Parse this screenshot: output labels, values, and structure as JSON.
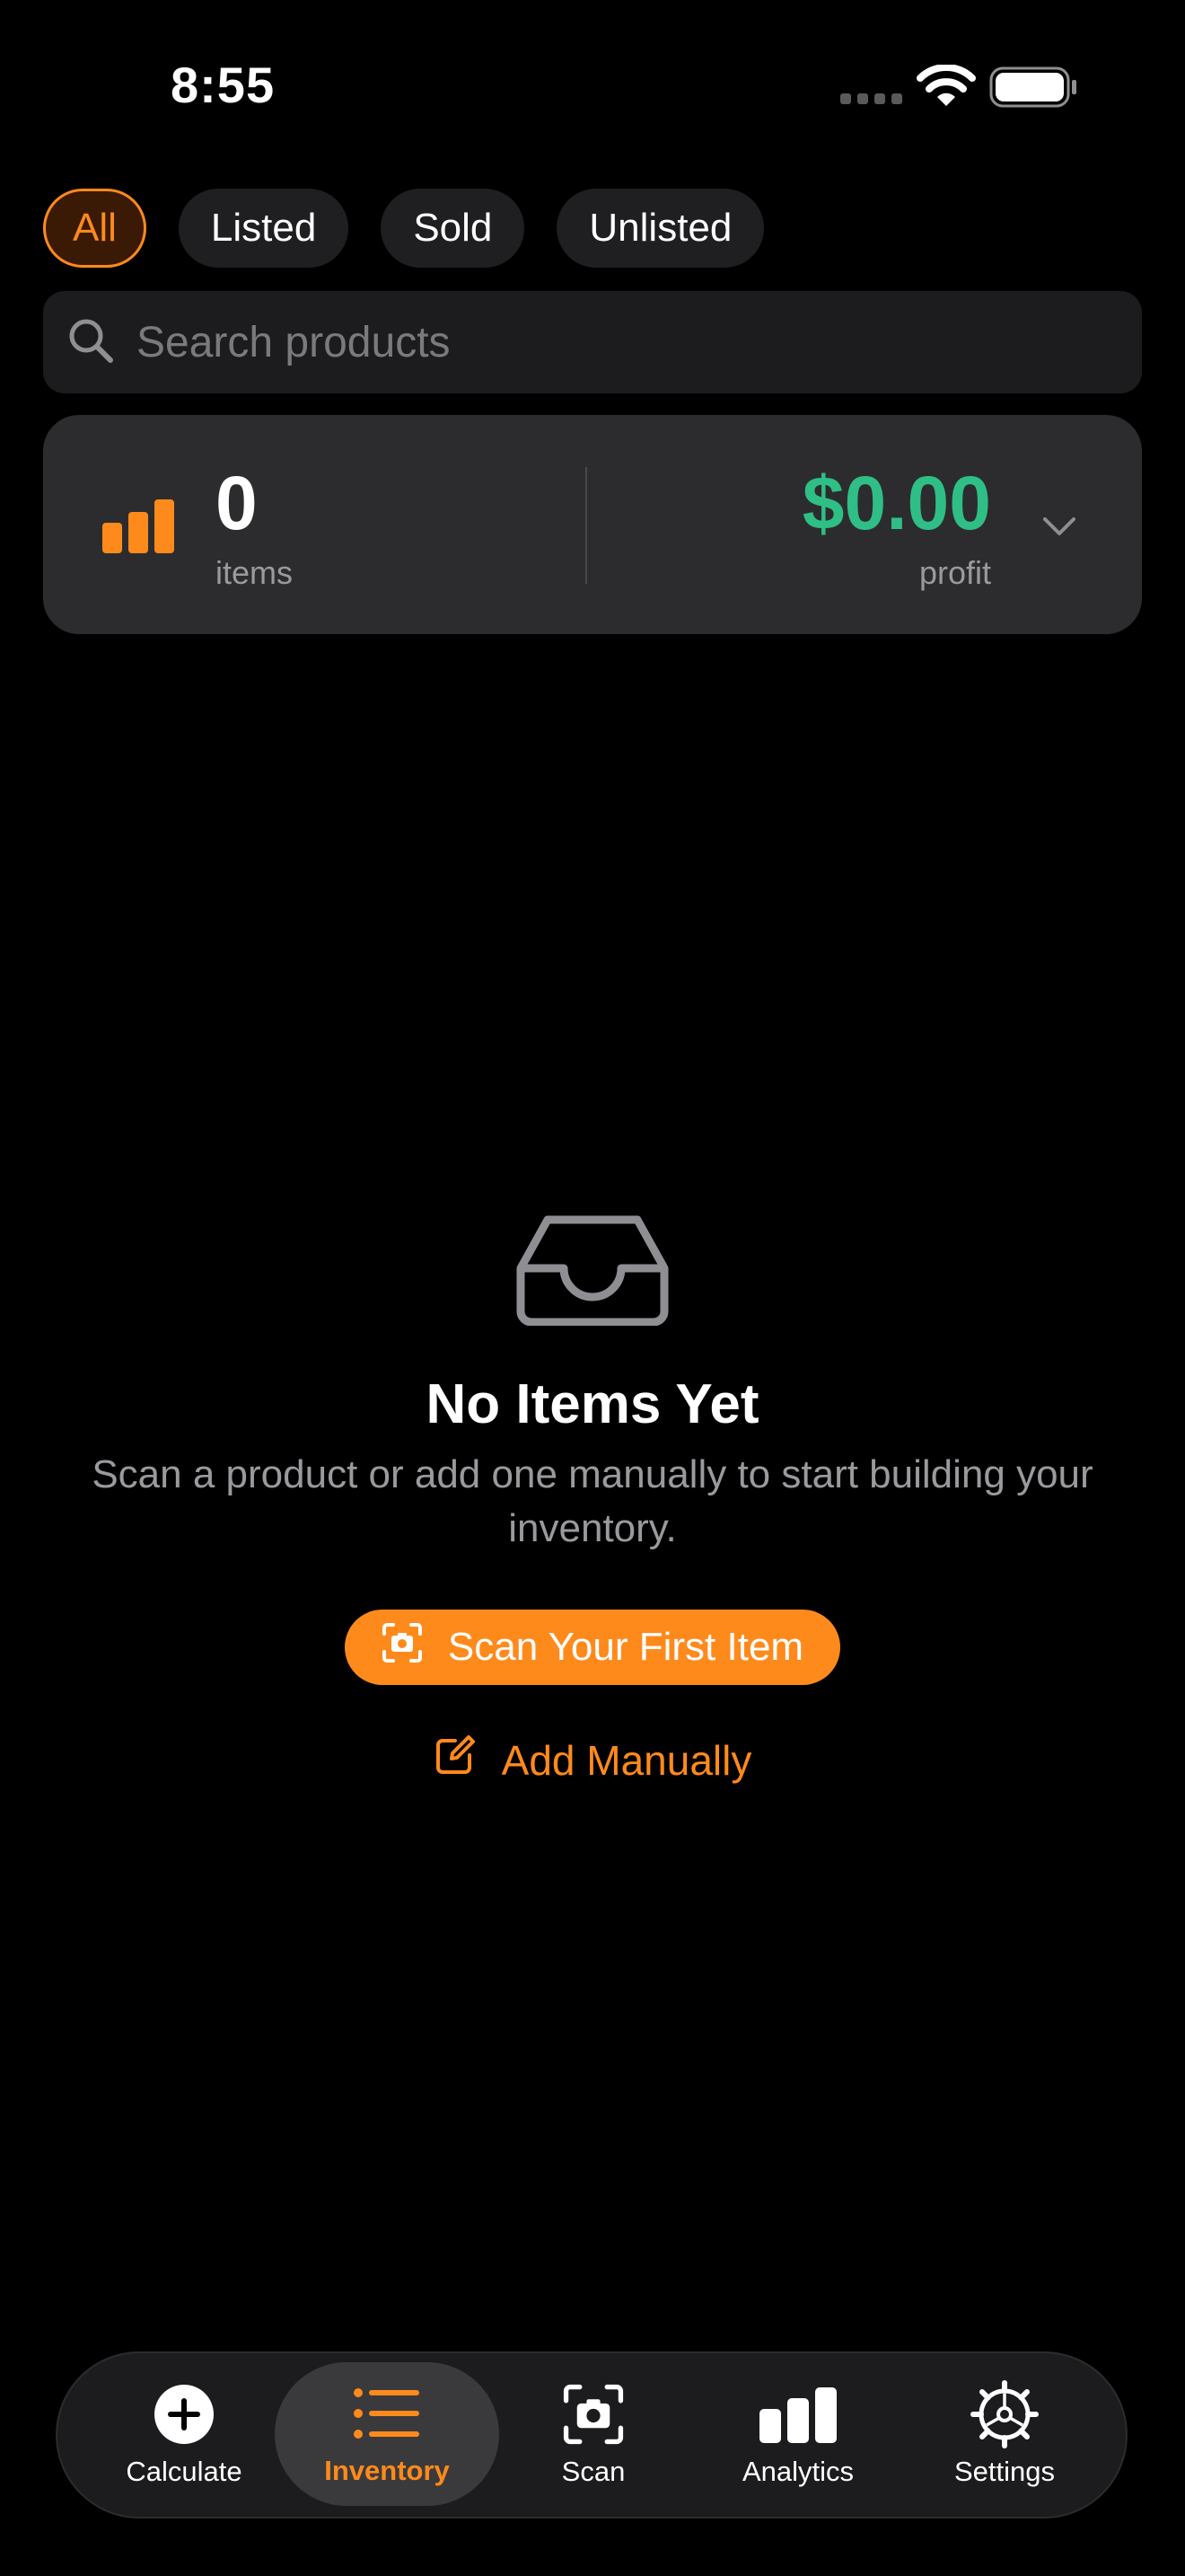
{
  "status_bar": {
    "time": "8:55"
  },
  "filters": {
    "chips": [
      {
        "label": "All",
        "active": true
      },
      {
        "label": "Listed",
        "active": false
      },
      {
        "label": "Sold",
        "active": false
      },
      {
        "label": "Unlisted",
        "active": false
      }
    ]
  },
  "search": {
    "placeholder": "Search products"
  },
  "summary": {
    "count": "0",
    "count_label": "items",
    "profit": "$0.00",
    "profit_label": "profit"
  },
  "empty_state": {
    "title": "No Items Yet",
    "message": "Scan a product or add one manually to start building your inventory.",
    "primary_button": "Scan Your First Item",
    "secondary_button": "Add Manually"
  },
  "tab_bar": {
    "tabs": [
      {
        "label": "Calculate",
        "icon": "plus-circle-icon"
      },
      {
        "label": "Inventory",
        "icon": "list-icon",
        "active": true
      },
      {
        "label": "Scan",
        "icon": "camera-viewfinder-icon"
      },
      {
        "label": "Analytics",
        "icon": "bar-chart-icon"
      },
      {
        "label": "Settings",
        "icon": "gear-icon"
      }
    ]
  },
  "colors": {
    "accent": "#ff8a1c",
    "profit": "#2fbf86",
    "background": "#000000",
    "card": "#2c2c2e"
  }
}
